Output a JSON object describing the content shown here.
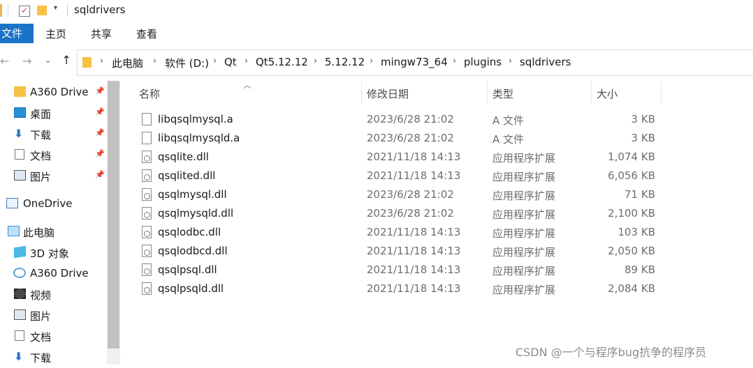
{
  "window": {
    "title": "sqldrivers"
  },
  "ribbon": {
    "tabs": [
      "文件",
      "主页",
      "共享",
      "查看"
    ]
  },
  "address": {
    "crumbs": [
      "此电脑",
      "软件 (D:)",
      "Qt",
      "Qt5.12.12",
      "5.12.12",
      "mingw73_64",
      "plugins",
      "sqldrivers"
    ]
  },
  "sidebar": {
    "items": [
      {
        "label": "A360 Drive",
        "icon": "folder-icon",
        "pinned": true
      },
      {
        "label": "桌面",
        "icon": "desktop-icon",
        "pinned": true
      },
      {
        "label": "下载",
        "icon": "download-icon",
        "pinned": true
      },
      {
        "label": "文档",
        "icon": "document-icon",
        "pinned": true
      },
      {
        "label": "图片",
        "icon": "pictures-icon",
        "pinned": true
      },
      {
        "label": "OneDrive",
        "icon": "onedrive-icon",
        "pinned": false
      },
      {
        "label": "此电脑",
        "icon": "computer-icon",
        "pinned": false
      },
      {
        "label": "3D 对象",
        "icon": "3d-objects-icon",
        "pinned": false
      },
      {
        "label": "A360 Drive",
        "icon": "a360-icon",
        "pinned": false
      },
      {
        "label": "视频",
        "icon": "video-icon",
        "pinned": false
      },
      {
        "label": "图片",
        "icon": "pictures-icon",
        "pinned": false
      },
      {
        "label": "文档",
        "icon": "document-icon",
        "pinned": false
      },
      {
        "label": "下载",
        "icon": "download-icon",
        "pinned": false
      }
    ]
  },
  "columns": {
    "name": "名称",
    "date": "修改日期",
    "type": "类型",
    "size": "大小"
  },
  "files": [
    {
      "name": "libqsqlmysql.a",
      "date": "2023/6/28 21:02",
      "type": "A 文件",
      "size": "3 KB",
      "kind": "file"
    },
    {
      "name": "libqsqlmysqld.a",
      "date": "2023/6/28 21:02",
      "type": "A 文件",
      "size": "3 KB",
      "kind": "file"
    },
    {
      "name": "qsqlite.dll",
      "date": "2021/11/18 14:13",
      "type": "应用程序扩展",
      "size": "1,074 KB",
      "kind": "dll"
    },
    {
      "name": "qsqlited.dll",
      "date": "2021/11/18 14:13",
      "type": "应用程序扩展",
      "size": "6,056 KB",
      "kind": "dll"
    },
    {
      "name": "qsqlmysql.dll",
      "date": "2023/6/28 21:02",
      "type": "应用程序扩展",
      "size": "71 KB",
      "kind": "dll"
    },
    {
      "name": "qsqlmysqld.dll",
      "date": "2023/6/28 21:02",
      "type": "应用程序扩展",
      "size": "2,100 KB",
      "kind": "dll"
    },
    {
      "name": "qsqlodbc.dll",
      "date": "2021/11/18 14:13",
      "type": "应用程序扩展",
      "size": "103 KB",
      "kind": "dll"
    },
    {
      "name": "qsqlodbcd.dll",
      "date": "2021/11/18 14:13",
      "type": "应用程序扩展",
      "size": "2,050 KB",
      "kind": "dll"
    },
    {
      "name": "qsqlpsql.dll",
      "date": "2021/11/18 14:13",
      "type": "应用程序扩展",
      "size": "89 KB",
      "kind": "dll"
    },
    {
      "name": "qsqlpsqld.dll",
      "date": "2021/11/18 14:13",
      "type": "应用程序扩展",
      "size": "2,084 KB",
      "kind": "dll"
    }
  ],
  "watermark": "CSDN @一个与程序bug抗争的程序员",
  "colors": {
    "accent": "#1a73c9",
    "folder": "#f5c242"
  }
}
